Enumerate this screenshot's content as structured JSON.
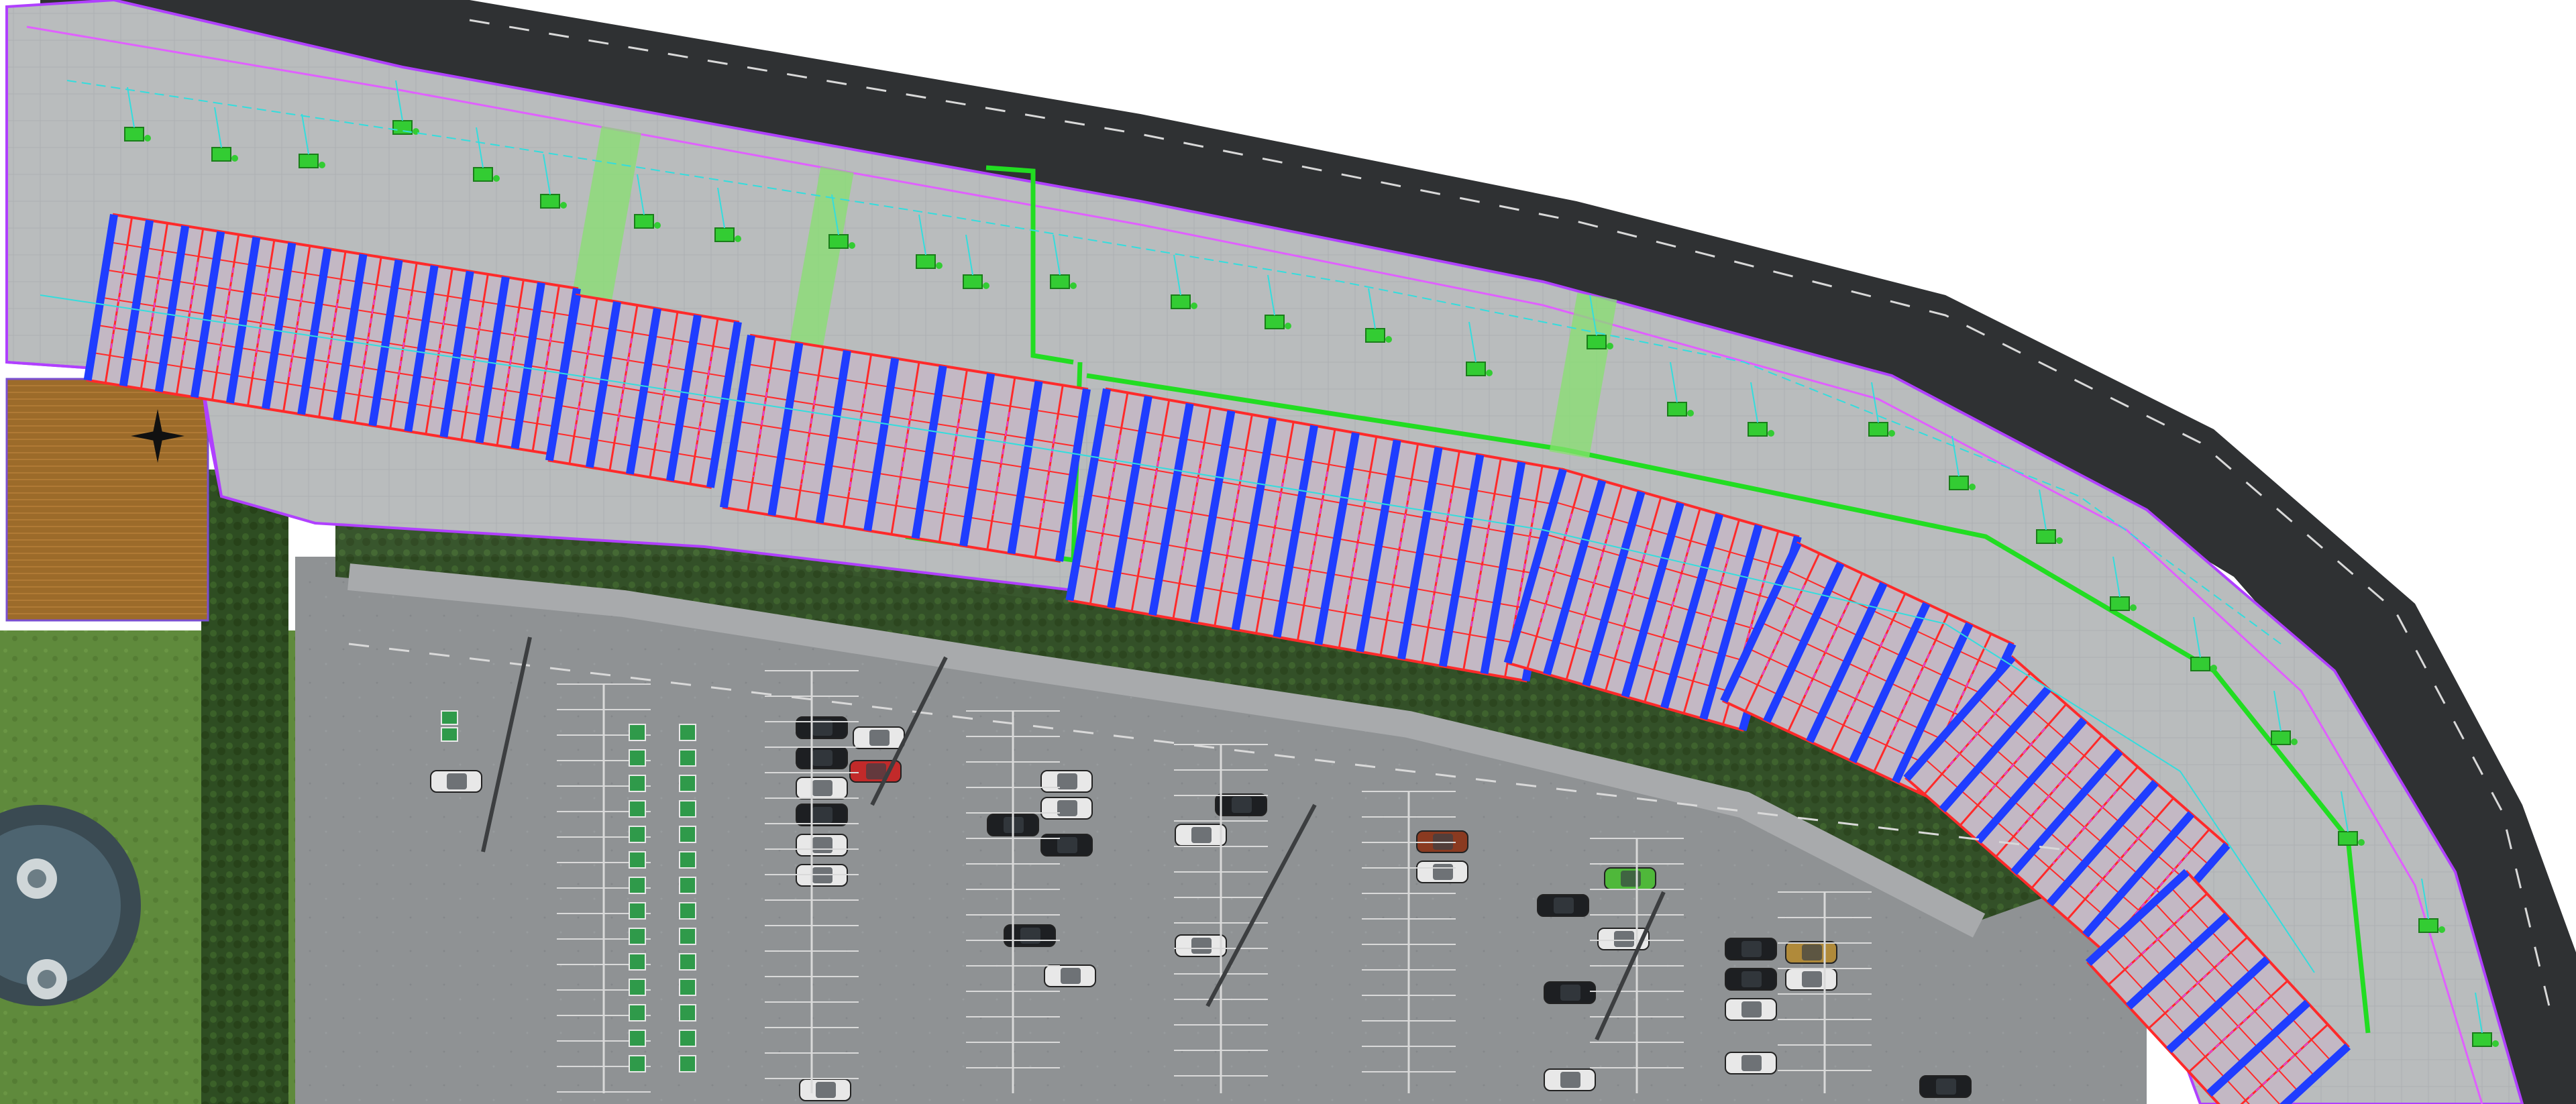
{
  "view": {
    "type": "aerial orthophoto with CAD overlay",
    "background": "#ffffff"
  },
  "colors": {
    "roof": "#b9bcbd",
    "roof_edge": "#9a9d9f",
    "road": "#2f3133",
    "road_marking": "#d9d9d9",
    "car_park": "#8f9294",
    "grass": "#5f8a3c",
    "hedge": "#2e4d22",
    "solar_frame_red": "#ff2a2a",
    "solar_frame_blue": "#1f3dff",
    "solar_magenta": "#e040e0",
    "boundary_purple": "#b040ff",
    "green_zone": "#22dd22",
    "cyan_conduit": "#33dddd",
    "plant_green": "#33cc33",
    "yellow_text": "#f0d020",
    "bay_sign_green": "#2f9a4a"
  },
  "overlay_labels": [
    {
      "text": ""
    }
  ],
  "icons": [
    "north-arrow-icon",
    "hvac-unit-icon",
    "parked-car-icon",
    "ev-bay-sign-icon"
  ]
}
